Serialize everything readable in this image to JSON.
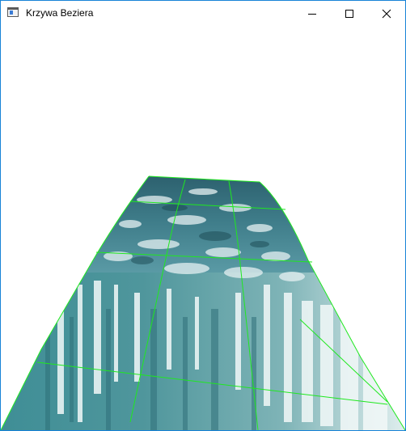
{
  "window": {
    "title": "Krzywa Beziera",
    "border_color": "#1883d7",
    "icon": "app-window-icon",
    "controls": {
      "minimize_icon": "minimize-icon",
      "maximize_icon": "maximize-icon",
      "close_icon": "close-icon"
    }
  },
  "scene": {
    "background": "#ffffff",
    "surface_texture": "water",
    "grid_color": "#1fe81f"
  }
}
